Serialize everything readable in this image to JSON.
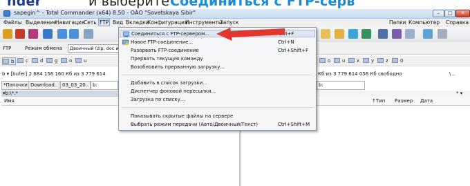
{
  "header": {
    "part1": "nder",
    "part2": "и выберите",
    "part3": "Соединиться с FTP-серв"
  },
  "window": {
    "title": "sapegin^ - Total Commander (x64) 8.50 - ОАО \"Sovetskaya Sibir\"",
    "min": "–",
    "max": "□",
    "close": "✕"
  },
  "menubar": {
    "items": [
      "Файлы",
      "Выделение",
      "Навигация",
      "Сеть",
      "FTP",
      "Вид",
      "Вкладки",
      "Конфигурация",
      "Инструменты",
      "Запуск"
    ],
    "right_items": [
      "Папки",
      "Компьютер",
      "Справка"
    ]
  },
  "ftp_bar": {
    "label": "FTP",
    "mode_label": "Режим обмена",
    "mode_value": "Двоичный (zip, doc и"
  },
  "drives": {
    "left": [
      "b",
      "c",
      "d",
      "g",
      "o",
      "u"
    ],
    "right": [
      "o",
      "u",
      "x",
      "y",
      "z",
      "0"
    ]
  },
  "left_panel": {
    "drive_line": "b  ▾  [bufer]  2 684 156 160 Кб из 3 779 614",
    "tabs": [
      "*Папочки",
      "Download..",
      "03_03_20..",
      "b:"
    ],
    "path": "▾b:\\*.*",
    "column_name": "Имя"
  },
  "right_panel": {
    "drive_line": "Кб из 3 779 614 056 Кб свободно",
    "backslash": "\\  ..",
    "tab": "b:",
    "asterisk": "* ▾",
    "columns": [
      "↑Тип",
      "Размер",
      "Дата"
    ]
  },
  "ftp_menu": {
    "items": [
      {
        "label": "Соединиться с FTP-сервером...",
        "shortcut": "Ctrl+F",
        "highlight": true
      },
      {
        "label": "Новое FTP-соединение...",
        "shortcut": "Ctrl+N"
      },
      {
        "label": "Разорвать FTP-соединение",
        "shortcut": "Ctrl+Shift+F"
      },
      {
        "label": "Прервать текущую команду",
        "shortcut": ""
      },
      {
        "label": "Возобновить прерванную загрузку...",
        "shortcut": ""
      },
      {
        "label": "Добавить в список загрузки...",
        "shortcut": ""
      },
      {
        "label": "Диспетчер фоновой пересылки...",
        "shortcut": ""
      },
      {
        "label": "Загрузка по списку...",
        "shortcut": ""
      },
      {
        "label": "Показывать скрытые файлы на сервере",
        "shortcut": ""
      },
      {
        "label": "Выбрать режим передачи (Авто/Двоичный/Текст)",
        "shortcut": "Ctrl+Shift+M"
      }
    ]
  },
  "colors": {
    "arrow": "#e0382f",
    "header_bold": "#1d3d8f",
    "header_cyan": "#1a8cd8"
  },
  "icons": [
    "connect-icon",
    "new-connection-icon",
    "arrow-icon"
  ]
}
